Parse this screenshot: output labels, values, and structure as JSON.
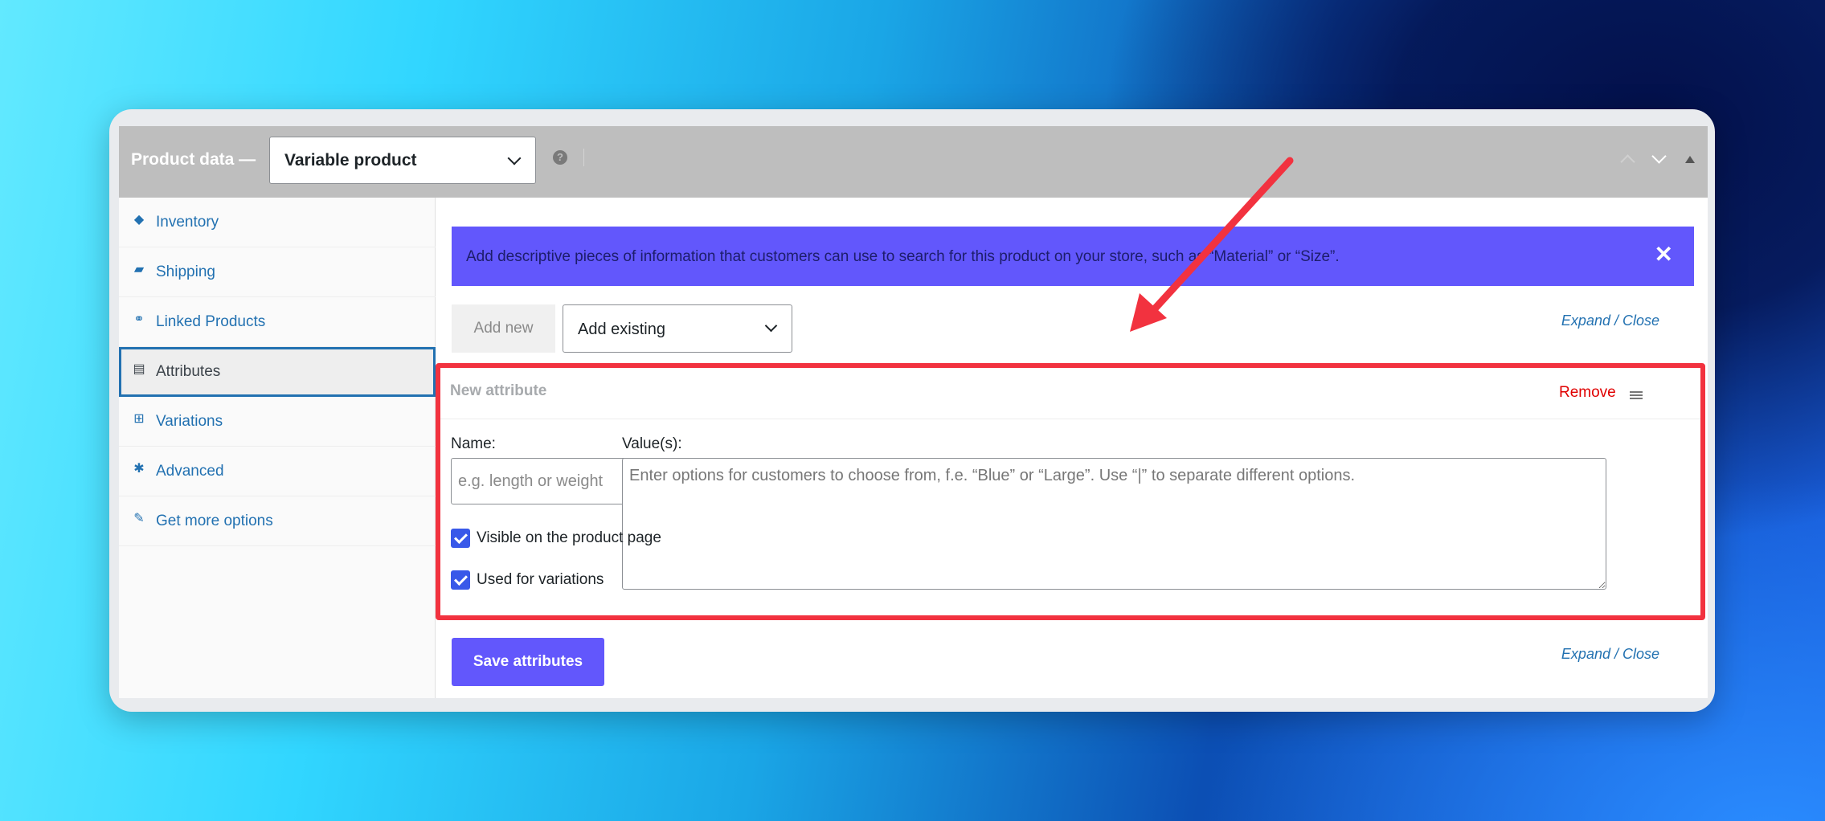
{
  "header": {
    "title": "Product data —",
    "product_type": "Variable product",
    "help_icon": "question-circle-icon"
  },
  "sidebar": {
    "items": [
      {
        "label": "Inventory",
        "icon": "tag-icon",
        "active": false
      },
      {
        "label": "Shipping",
        "icon": "truck-icon",
        "active": false
      },
      {
        "label": "Linked Products",
        "icon": "link-icon",
        "active": false
      },
      {
        "label": "Attributes",
        "icon": "list-icon",
        "active": true
      },
      {
        "label": "Variations",
        "icon": "grid-icon",
        "active": false
      },
      {
        "label": "Advanced",
        "icon": "gear-icon",
        "active": false
      },
      {
        "label": "Get more options",
        "icon": "plugin-icon",
        "active": false
      }
    ]
  },
  "notice": {
    "text": "Add descriptive pieces of information that customers can use to search for this product on your store, such as “Material” or “Size”.",
    "close": "✕"
  },
  "toolbar": {
    "add_new": "Add new",
    "add_existing": "Add existing",
    "expand_close": "Expand / Close"
  },
  "attribute": {
    "title": "New attribute",
    "remove": "Remove",
    "name_label": "Name:",
    "name_placeholder": "e.g. length or weight",
    "values_label": "Value(s):",
    "values_placeholder": "Enter options for customers to choose from, f.e. “Blue” or “Large”. Use “|” to separate different options.",
    "visible_label": "Visible on the product page",
    "visible_checked": true,
    "variations_label": "Used for variations",
    "variations_checked": true
  },
  "footer": {
    "save": "Save attributes",
    "expand_close": "Expand / Close"
  },
  "colors": {
    "accent": "#6257fc",
    "highlight": "#f2323f",
    "link": "#2271b1"
  }
}
